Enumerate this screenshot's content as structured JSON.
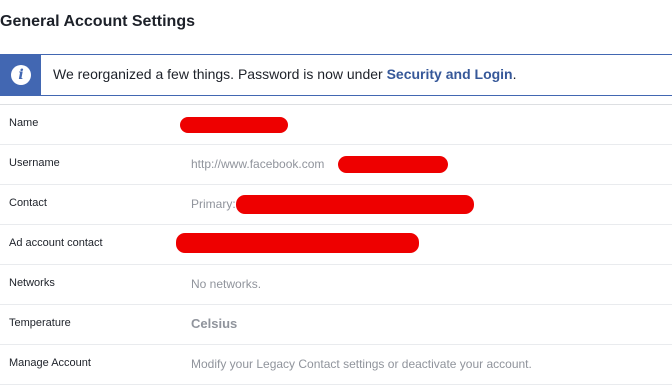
{
  "page": {
    "title": "General Account Settings"
  },
  "notice": {
    "icon": "info-icon",
    "text": "We reorganized a few things. Password is now under ",
    "link": "Security and Login",
    "suffix": "."
  },
  "rows": [
    {
      "label": "Name",
      "value": ""
    },
    {
      "label": "Username",
      "value": "http://www.facebook.com"
    },
    {
      "label": "Contact",
      "value": "Primary:"
    },
    {
      "label": "Ad account contact",
      "value": ""
    },
    {
      "label": "Networks",
      "value": "No networks."
    },
    {
      "label": "Temperature",
      "value": "Celsius"
    },
    {
      "label": "Manage Account",
      "value": "Modify your Legacy Contact settings or deactivate your account."
    }
  ],
  "colors": {
    "accent": "#4267b2",
    "link": "#365899",
    "redaction": "#ee0000"
  }
}
